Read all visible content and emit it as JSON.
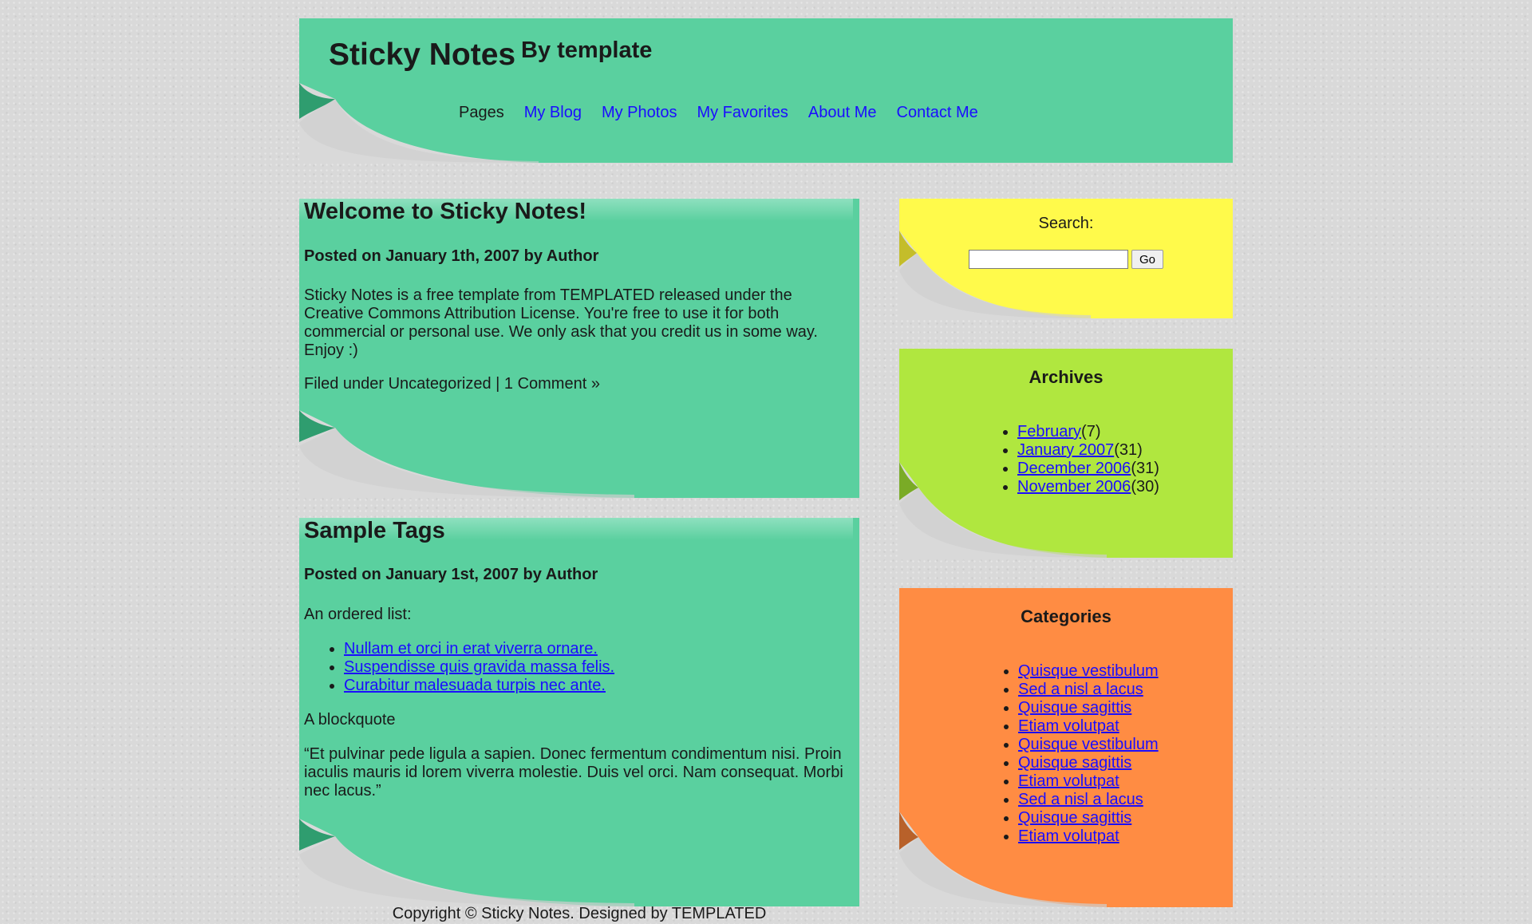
{
  "header": {
    "site_title": "Sticky Notes",
    "site_subtitle": "By template",
    "nav": [
      {
        "label": "Pages",
        "current": true
      },
      {
        "label": "My Blog"
      },
      {
        "label": "My Photos"
      },
      {
        "label": "My Favorites"
      },
      {
        "label": "About Me"
      },
      {
        "label": "Contact Me"
      }
    ]
  },
  "posts": [
    {
      "title": "Welcome to Sticky Notes!",
      "meta": "Posted on January 1th, 2007 by Author",
      "body": "Sticky Notes is a free template from TEMPLATED released under the Creative Commons Attribution License. You're free to use it for both commercial or personal use. We only ask that you credit us in some way. Enjoy :)",
      "footer": "Filed under Uncategorized | 1 Comment »"
    },
    {
      "title": "Sample Tags",
      "meta": "Posted on January 1st, 2007 by Author",
      "list_intro": "An ordered list:",
      "list": [
        "Nullam et orci in erat viverra ornare.",
        "Suspendisse quis gravida massa felis.",
        "Curabitur malesuada turpis nec ante."
      ],
      "quote_intro": "A blockquote",
      "quote": "“Et pulvinar pede ligula a sapien. Donec fermentum condimentum nisi. Proin iaculis mauris id lorem viverra molestie. Duis vel orci. Nam consequat. Morbi nec lacus.”"
    }
  ],
  "sidebar": {
    "search": {
      "label": "Search:",
      "value": "",
      "button": "Go"
    },
    "archives": {
      "title": "Archives",
      "items": [
        {
          "label": "February",
          "count": "(7)"
        },
        {
          "label": "January 2007",
          "count": "(31)"
        },
        {
          "label": "December 2006",
          "count": "(31)"
        },
        {
          "label": "November 2006",
          "count": "(30)"
        }
      ]
    },
    "categories": {
      "title": "Categories",
      "items": [
        "Quisque vestibulum",
        "Sed a nisl a lacus",
        "Quisque sagittis",
        "Etiam volutpat",
        "Quisque vestibulum",
        "Quisque sagittis",
        "Etiam volutpat",
        "Sed a nisl a lacus",
        "Quisque sagittis",
        "Etiam volutpat"
      ]
    }
  },
  "footer": {
    "copyright": "Copyright © Sticky Notes. Designed by TEMPLATED"
  },
  "colors": {
    "background": "#d9d9d9",
    "green_note": "#5ad09f",
    "yellow_note": "#fffa4b",
    "lime_note": "#b0e73f",
    "orange_note": "#ff8c43",
    "link": "#1a0dff"
  }
}
